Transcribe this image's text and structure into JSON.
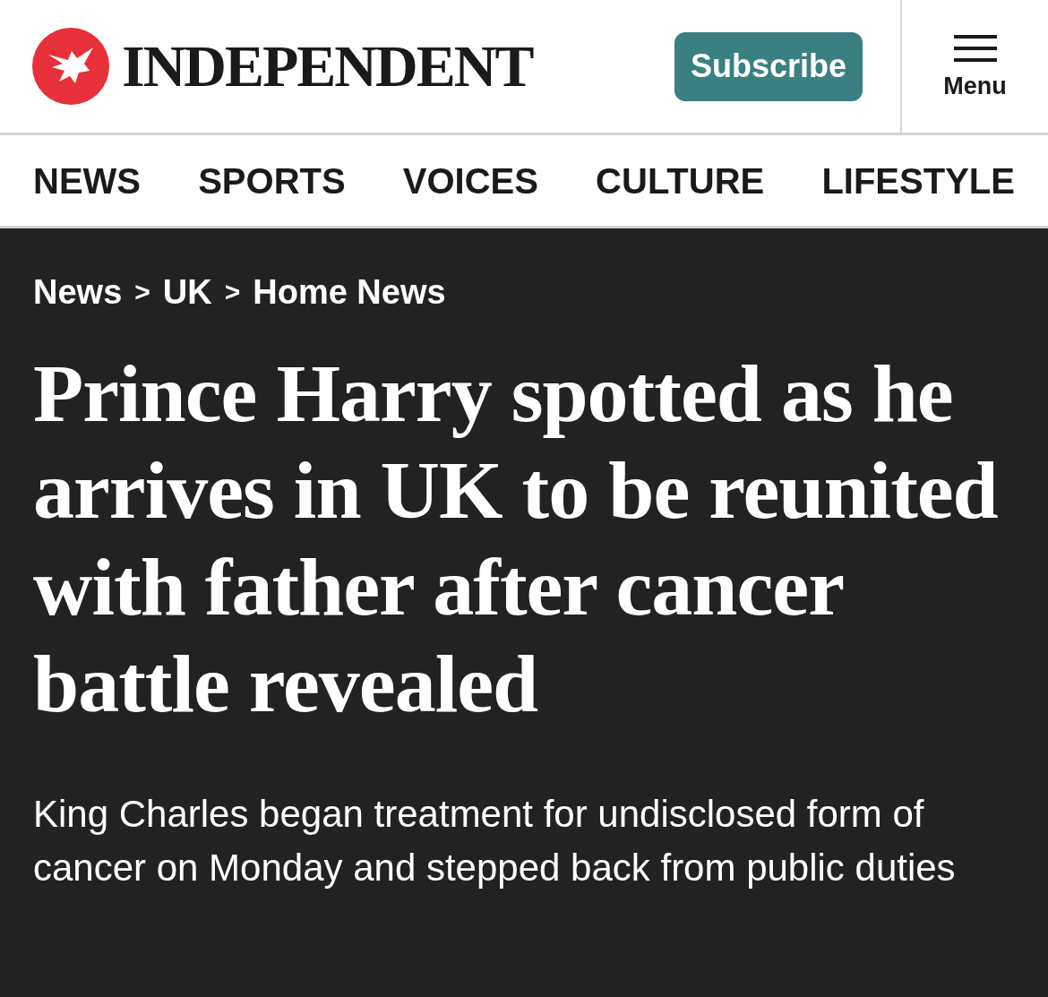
{
  "header": {
    "logo_text": "INDEPENDENT",
    "subscribe_button": "Subscribe",
    "menu_label": "Menu"
  },
  "nav": [
    {
      "label": "NEWS"
    },
    {
      "label": "SPORTS"
    },
    {
      "label": "VOICES"
    },
    {
      "label": "CULTURE"
    },
    {
      "label": "LIFESTYLE"
    }
  ],
  "breadcrumb": [
    "News",
    ">",
    "UK",
    ">",
    "Home News"
  ],
  "headline": "Prince Harry spotted as he arrives in UK to be reunited with father after cancer battle revealed",
  "standfirst": "King Charles began treatment for undisclosed form of cancer on Monday and stepped back from public duties"
}
